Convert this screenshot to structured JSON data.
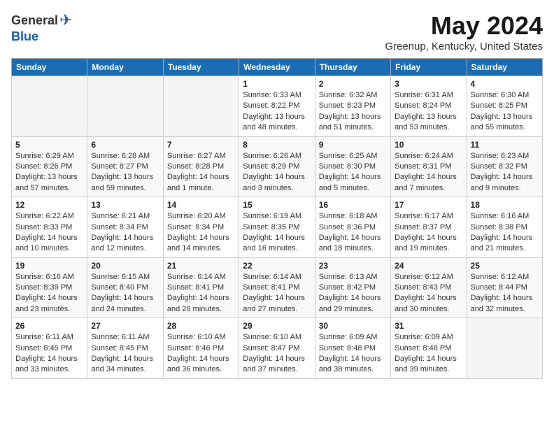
{
  "logo": {
    "general": "General",
    "blue": "Blue"
  },
  "title": "May 2024",
  "location": "Greenup, Kentucky, United States",
  "weekdays": [
    "Sunday",
    "Monday",
    "Tuesday",
    "Wednesday",
    "Thursday",
    "Friday",
    "Saturday"
  ],
  "weeks": [
    [
      {
        "day": "",
        "info": ""
      },
      {
        "day": "",
        "info": ""
      },
      {
        "day": "",
        "info": ""
      },
      {
        "day": "1",
        "info": "Sunrise: 6:33 AM\nSunset: 8:22 PM\nDaylight: 13 hours\nand 48 minutes."
      },
      {
        "day": "2",
        "info": "Sunrise: 6:32 AM\nSunset: 8:23 PM\nDaylight: 13 hours\nand 51 minutes."
      },
      {
        "day": "3",
        "info": "Sunrise: 6:31 AM\nSunset: 8:24 PM\nDaylight: 13 hours\nand 53 minutes."
      },
      {
        "day": "4",
        "info": "Sunrise: 6:30 AM\nSunset: 8:25 PM\nDaylight: 13 hours\nand 55 minutes."
      }
    ],
    [
      {
        "day": "5",
        "info": "Sunrise: 6:29 AM\nSunset: 8:26 PM\nDaylight: 13 hours\nand 57 minutes."
      },
      {
        "day": "6",
        "info": "Sunrise: 6:28 AM\nSunset: 8:27 PM\nDaylight: 13 hours\nand 59 minutes."
      },
      {
        "day": "7",
        "info": "Sunrise: 6:27 AM\nSunset: 8:28 PM\nDaylight: 14 hours\nand 1 minute."
      },
      {
        "day": "8",
        "info": "Sunrise: 6:26 AM\nSunset: 8:29 PM\nDaylight: 14 hours\nand 3 minutes."
      },
      {
        "day": "9",
        "info": "Sunrise: 6:25 AM\nSunset: 8:30 PM\nDaylight: 14 hours\nand 5 minutes."
      },
      {
        "day": "10",
        "info": "Sunrise: 6:24 AM\nSunset: 8:31 PM\nDaylight: 14 hours\nand 7 minutes."
      },
      {
        "day": "11",
        "info": "Sunrise: 6:23 AM\nSunset: 8:32 PM\nDaylight: 14 hours\nand 9 minutes."
      }
    ],
    [
      {
        "day": "12",
        "info": "Sunrise: 6:22 AM\nSunset: 8:33 PM\nDaylight: 14 hours\nand 10 minutes."
      },
      {
        "day": "13",
        "info": "Sunrise: 6:21 AM\nSunset: 8:34 PM\nDaylight: 14 hours\nand 12 minutes."
      },
      {
        "day": "14",
        "info": "Sunrise: 6:20 AM\nSunset: 8:34 PM\nDaylight: 14 hours\nand 14 minutes."
      },
      {
        "day": "15",
        "info": "Sunrise: 6:19 AM\nSunset: 8:35 PM\nDaylight: 14 hours\nand 16 minutes."
      },
      {
        "day": "16",
        "info": "Sunrise: 6:18 AM\nSunset: 8:36 PM\nDaylight: 14 hours\nand 18 minutes."
      },
      {
        "day": "17",
        "info": "Sunrise: 6:17 AM\nSunset: 8:37 PM\nDaylight: 14 hours\nand 19 minutes."
      },
      {
        "day": "18",
        "info": "Sunrise: 6:16 AM\nSunset: 8:38 PM\nDaylight: 14 hours\nand 21 minutes."
      }
    ],
    [
      {
        "day": "19",
        "info": "Sunrise: 6:16 AM\nSunset: 8:39 PM\nDaylight: 14 hours\nand 23 minutes."
      },
      {
        "day": "20",
        "info": "Sunrise: 6:15 AM\nSunset: 8:40 PM\nDaylight: 14 hours\nand 24 minutes."
      },
      {
        "day": "21",
        "info": "Sunrise: 6:14 AM\nSunset: 8:41 PM\nDaylight: 14 hours\nand 26 minutes."
      },
      {
        "day": "22",
        "info": "Sunrise: 6:14 AM\nSunset: 8:41 PM\nDaylight: 14 hours\nand 27 minutes."
      },
      {
        "day": "23",
        "info": "Sunrise: 6:13 AM\nSunset: 8:42 PM\nDaylight: 14 hours\nand 29 minutes."
      },
      {
        "day": "24",
        "info": "Sunrise: 6:12 AM\nSunset: 8:43 PM\nDaylight: 14 hours\nand 30 minutes."
      },
      {
        "day": "25",
        "info": "Sunrise: 6:12 AM\nSunset: 8:44 PM\nDaylight: 14 hours\nand 32 minutes."
      }
    ],
    [
      {
        "day": "26",
        "info": "Sunrise: 6:11 AM\nSunset: 8:45 PM\nDaylight: 14 hours\nand 33 minutes."
      },
      {
        "day": "27",
        "info": "Sunrise: 6:11 AM\nSunset: 8:45 PM\nDaylight: 14 hours\nand 34 minutes."
      },
      {
        "day": "28",
        "info": "Sunrise: 6:10 AM\nSunset: 8:46 PM\nDaylight: 14 hours\nand 36 minutes."
      },
      {
        "day": "29",
        "info": "Sunrise: 6:10 AM\nSunset: 8:47 PM\nDaylight: 14 hours\nand 37 minutes."
      },
      {
        "day": "30",
        "info": "Sunrise: 6:09 AM\nSunset: 8:48 PM\nDaylight: 14 hours\nand 38 minutes."
      },
      {
        "day": "31",
        "info": "Sunrise: 6:09 AM\nSunset: 8:48 PM\nDaylight: 14 hours\nand 39 minutes."
      },
      {
        "day": "",
        "info": ""
      }
    ]
  ]
}
